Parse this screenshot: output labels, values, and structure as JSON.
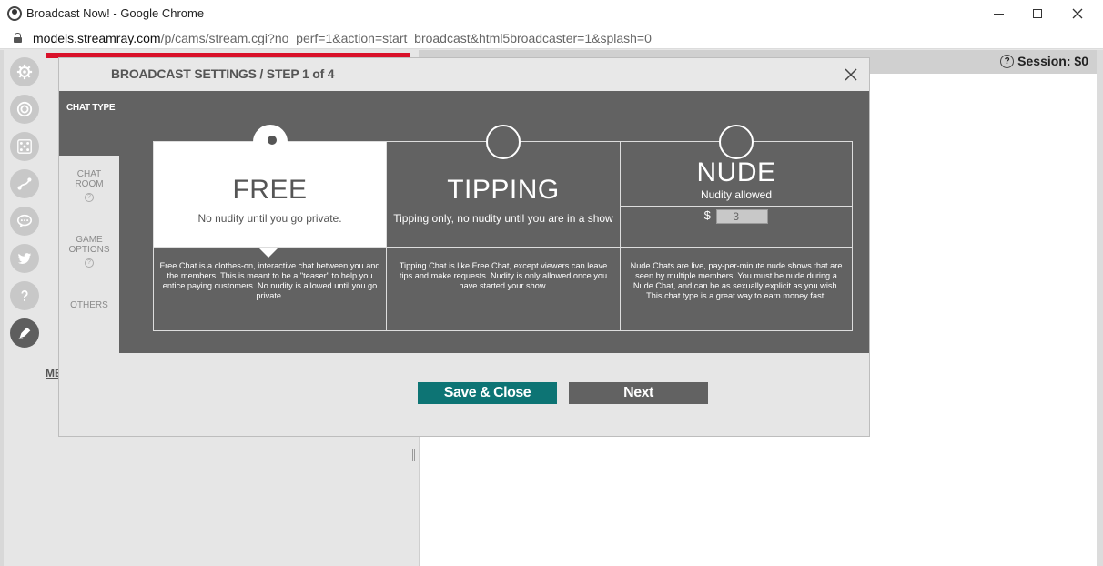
{
  "window": {
    "title": "Broadcast Now! - Google Chrome",
    "url_host": "models.streamray.com",
    "url_path": "/p/cams/stream.cgi?no_perf=1&action=start_broadcast&html5broadcaster=1&splash=0"
  },
  "page": {
    "session_label": "Session: $0",
    "me_link": "ME"
  },
  "sidebar_icons": [
    "gear-icon",
    "target-icon",
    "dice-icon",
    "path-icon",
    "chat-icon",
    "twitter-icon",
    "help-icon",
    "pen-icon"
  ],
  "modal": {
    "title": "BROADCAST SETTINGS / STEP 1 of 4",
    "section_label": "CHAT TYPE",
    "steps": [
      {
        "label": "CHAT ROOM",
        "help": "?"
      },
      {
        "label": "GAME OPTIONS",
        "help": "?"
      },
      {
        "label": "OTHERS"
      }
    ],
    "options": [
      {
        "name": "FREE",
        "subtitle": "No nudity until you go private.",
        "description": "Free Chat is a clothes-on, interactive chat between you and the members. This is meant to be a \"teaser\" to help you entice paying customers. No nudity is allowed until you go private.",
        "selected": true
      },
      {
        "name": "TIPPING",
        "subtitle": "Tipping only, no nudity until you are in a show",
        "description": "Tipping Chat is like Free Chat, except viewers can leave tips and make requests. Nudity is only allowed once you have started your show.",
        "selected": false
      },
      {
        "name": "NUDE",
        "subtitle": "Nudity allowed",
        "currency": "$",
        "price": "3",
        "description": "Nude Chats are live, pay-per-minute nude shows that are seen by multiple members. You must be nude during a Nude Chat, and can be as sexually explicit as you wish. This chat type is a great way to earn money fast.",
        "selected": false
      }
    ],
    "save_label": "Save & Close",
    "next_label": "Next"
  },
  "colors": {
    "modal_body": "#626262",
    "save_button": "#0d7474",
    "banner_red": "#d9112a"
  }
}
